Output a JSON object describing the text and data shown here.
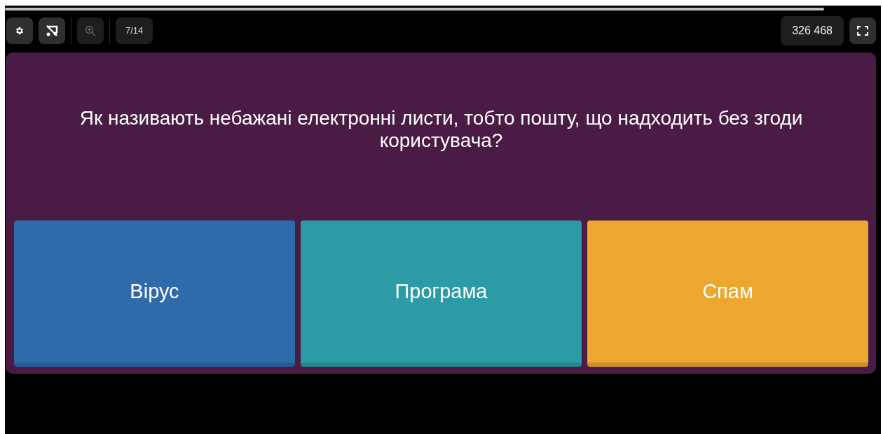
{
  "progress": {
    "level": 0.935
  },
  "toolbar": {
    "settings": {
      "disabled": false
    },
    "music": {
      "disabled": false
    },
    "zoom": {
      "disabled": true
    },
    "counter": "7/14",
    "score": "326 468"
  },
  "question": "Як називають небажані електронні листи, тобто пошту, що надходить без згоди користувача?",
  "answers": [
    {
      "label": "Вірус",
      "color": "#2f6aab"
    },
    {
      "label": "Програма",
      "color": "#2d9ba5"
    },
    {
      "label": "Спам",
      "color": "#eba72f"
    }
  ]
}
